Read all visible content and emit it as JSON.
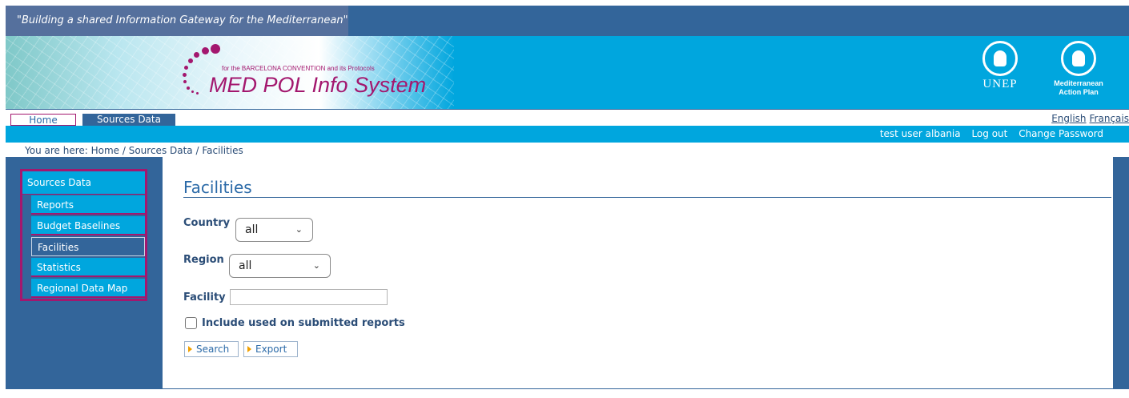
{
  "tagline": "\"Building a shared Information Gateway for the Mediterranean\"",
  "logo": {
    "subtitle": "for the BARCELONA CONVENTION and its Protocols",
    "title": "MED POL Info System"
  },
  "partners": {
    "unep_label": "UNEP",
    "map_label_line1": "Mediterranean",
    "map_label_line2": "Action Plan"
  },
  "nav": {
    "tabs": [
      {
        "label": "Home"
      },
      {
        "label": "Sources Data"
      }
    ],
    "languages": [
      "English",
      "Français"
    ]
  },
  "user_bar": {
    "user": "test user albania",
    "logout": "Log out",
    "change_password": "Change Password"
  },
  "breadcrumb": "You are here: Home / Sources Data / Facilities",
  "sidebar": {
    "heading": "Sources Data",
    "items": [
      {
        "label": "Reports"
      },
      {
        "label": "Budget Baselines"
      },
      {
        "label": "Facilities",
        "active": true
      },
      {
        "label": "Statistics"
      },
      {
        "label": "Regional Data Map"
      }
    ]
  },
  "main": {
    "title": "Facilities",
    "country_label": "Country",
    "country_value": "all",
    "region_label": "Region",
    "region_value": "all",
    "facility_label": "Facility",
    "facility_value": "",
    "include_label": "Include used on submitted reports",
    "search_button": "Search",
    "export_button": "Export"
  },
  "colors": {
    "brand_blue": "#33659a",
    "cyan": "#00a6de",
    "magenta": "#a3176e"
  }
}
